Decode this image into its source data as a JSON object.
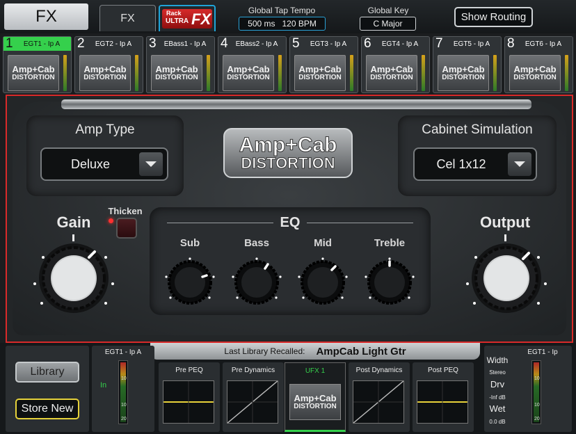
{
  "header": {
    "title": "FX",
    "tab_fx": "FX",
    "rack_logo": {
      "line1": "Rack",
      "line2": "ULTRA",
      "line3": "FX"
    },
    "tap_tempo_label": "Global Tap Tempo",
    "tap_tempo_ms": "500 ms",
    "tap_tempo_bpm": "120 BPM",
    "global_key_label": "Global Key",
    "global_key_value": "C Major",
    "show_routing": "Show Routing"
  },
  "slots": [
    {
      "num": "1",
      "name": "EGT1 - Ip A",
      "active": true
    },
    {
      "num": "2",
      "name": "EGT2 - Ip A",
      "active": false
    },
    {
      "num": "3",
      "name": "EBass1 - Ip A",
      "active": false
    },
    {
      "num": "4",
      "name": "EBass2 - Ip A",
      "active": false
    },
    {
      "num": "5",
      "name": "EGT3 - Ip A",
      "active": false
    },
    {
      "num": "6",
      "name": "EGT4 - Ip A",
      "active": false
    },
    {
      "num": "7",
      "name": "EGT5 - Ip A",
      "active": false
    },
    {
      "num": "8",
      "name": "EGT6 - Ip A",
      "active": false
    }
  ],
  "slot_thumb": {
    "line1": "Amp+Cab",
    "line2": "DISTORTION"
  },
  "plugin": {
    "amp_type_label": "Amp Type",
    "amp_type_value": "Deluxe",
    "cab_label": "Cabinet Simulation",
    "cab_value": "Cel 1x12",
    "logo_line1": "Amp+Cab",
    "logo_line2": "DISTORTION",
    "gain_label": "Gain",
    "thicken_label": "Thicken",
    "eq_label": "EQ",
    "sub_label": "Sub",
    "bass_label": "Bass",
    "mid_label": "Mid",
    "treble_label": "Treble",
    "output_label": "Output"
  },
  "bottom": {
    "last_library_label": "Last Library Recalled:",
    "last_library_value": "AmpCab Light Gtr",
    "library_button": "Library",
    "store_button": "Store New",
    "input_title": "EGT1 - Ip A",
    "input_label": "In",
    "meter_scale": [
      "10",
      "10",
      "20"
    ],
    "pre_peq": "Pre PEQ",
    "pre_dynamics": "Pre Dynamics",
    "ufx": "UFX 1",
    "post_dynamics": "Post Dynamics",
    "post_peq": "Post PEQ",
    "output_title": "EGT1 - Ip",
    "width_label": "Width",
    "width_value": "Stereo",
    "drv_label": "Drv",
    "drv_value": "-Inf dB",
    "wet_label": "Wet",
    "wet_value": "0.0 dB"
  },
  "colors": {
    "accent_green": "#35d04c",
    "accent_blue": "#29a1d6",
    "highlight_red": "#d92a2a",
    "store_yellow": "#e6d23a"
  }
}
